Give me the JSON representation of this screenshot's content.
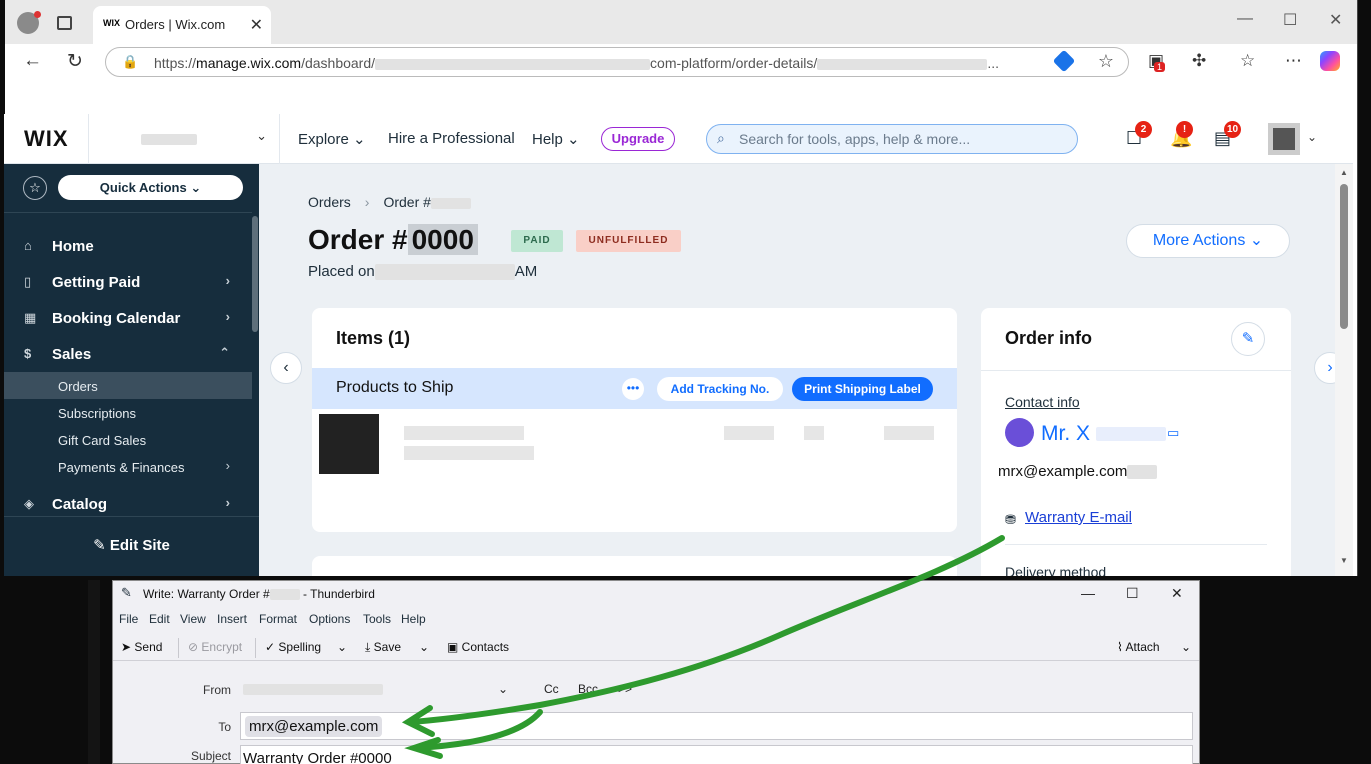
{
  "browser": {
    "tab_title": "Orders | Wix.com",
    "tab_favicon": "WIX",
    "url_prefix": "https://",
    "url_host": "manage.wix.com",
    "url_path1": "/dashboard/",
    "url_path2": "com-platform/order-details/",
    "url_ellipsis": "..."
  },
  "wix": {
    "logo": "WIX",
    "nav": {
      "explore": "Explore",
      "hire": "Hire a Professional",
      "help": "Help",
      "upgrade": "Upgrade"
    },
    "search_placeholder": "Search for tools, apps, help & more...",
    "badges": {
      "messages": "2",
      "notifications": "!",
      "inbox": "10"
    }
  },
  "sidebar": {
    "quick_actions": "Quick Actions",
    "items": [
      {
        "label": "Home"
      },
      {
        "label": "Getting Paid"
      },
      {
        "label": "Booking Calendar"
      },
      {
        "label": "Sales"
      }
    ],
    "sub_items": [
      {
        "label": "Orders"
      },
      {
        "label": "Subscriptions"
      },
      {
        "label": "Gift Card Sales"
      },
      {
        "label": "Payments & Finances"
      }
    ],
    "catalog": "Catalog",
    "edit_site": "Edit Site"
  },
  "order": {
    "breadcrumb_orders": "Orders",
    "breadcrumb_order": "Order #",
    "title_prefix": "Order #",
    "title_number": "0000",
    "status_paid": "PAID",
    "status_fulfillment": "UNFULFILLED",
    "placed_on": "Placed on",
    "placed_suffix": "AM",
    "more_actions": "More Actions",
    "items_title": "Items (1)",
    "products_to_ship": "Products to Ship",
    "dots": "•••",
    "add_tracking": "Add Tracking No.",
    "print_label": "Print Shipping Label"
  },
  "order_info": {
    "title": "Order info",
    "contact_info": "Contact info",
    "contact_name": "Mr. X",
    "contact_email": "mrx@example.com",
    "warranty_link": "Warranty E-mail",
    "delivery_method": "Delivery method"
  },
  "thunderbird": {
    "title_prefix": "Write: Warranty Order #",
    "title_suffix": "- Thunderbird",
    "menu": [
      "File",
      "Edit",
      "View",
      "Insert",
      "Format",
      "Options",
      "Tools",
      "Help"
    ],
    "toolbar": {
      "send": "Send",
      "encrypt": "Encrypt",
      "spelling": "Spelling",
      "save": "Save",
      "contacts": "Contacts",
      "attach": "Attach"
    },
    "labels": {
      "from": "From",
      "to": "To",
      "subject": "Subject",
      "cc": "Cc",
      "bcc": "Bcc",
      "more": ">>"
    },
    "to_value": "mrx@example.com",
    "subject_value": "Warranty Order #0000"
  },
  "colors": {
    "accent": "#116dff",
    "sidebar": "#162d3d",
    "annotation": "#2e9a2e"
  }
}
